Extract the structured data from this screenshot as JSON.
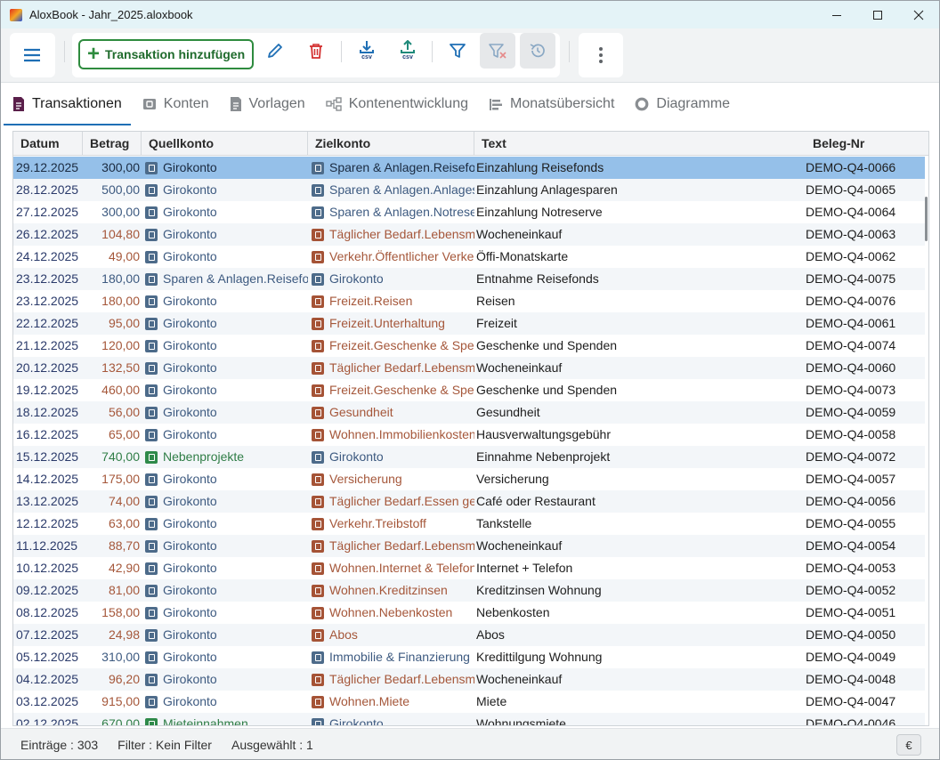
{
  "window": {
    "title": "AloxBook - Jahr_2025.aloxbook"
  },
  "toolbar": {
    "add_label": "Transaktion hinzufügen",
    "csv_label": "csv"
  },
  "tabs": [
    {
      "label": "Transaktionen",
      "icon": "document-icon",
      "active": true
    },
    {
      "label": "Konten",
      "icon": "wallet-icon"
    },
    {
      "label": "Vorlagen",
      "icon": "template-icon"
    },
    {
      "label": "Kontenentwicklung",
      "icon": "hierarchy-icon"
    },
    {
      "label": "Monatsübersicht",
      "icon": "list-icon"
    },
    {
      "label": "Diagramme",
      "icon": "donut-chart-icon"
    }
  ],
  "columns": [
    "Datum",
    "Betrag",
    "Quellkonto",
    "Zielkonto",
    "Text",
    "Beleg-Nr"
  ],
  "colors": {
    "asset": "#3d5a80",
    "expense": "#a5573a",
    "income": "#2f7d46",
    "selected_row": "#95c0e9"
  },
  "rows": [
    {
      "date": "29.12.2025",
      "amount": "300,00",
      "amount_type": "asset",
      "src": "Girokonto",
      "src_type": "asset",
      "dst": "Sparen & Anlagen.Reisefonds",
      "dst_type": "asset",
      "text": "Einzahlung Reisefonds",
      "beleg": "DEMO-Q4-0066",
      "selected": true
    },
    {
      "date": "28.12.2025",
      "amount": "500,00",
      "amount_type": "asset",
      "src": "Girokonto",
      "src_type": "asset",
      "dst": "Sparen & Anlagen.Anlagesparen",
      "dst_type": "asset",
      "text": "Einzahlung Anlagesparen",
      "beleg": "DEMO-Q4-0065"
    },
    {
      "date": "27.12.2025",
      "amount": "300,00",
      "amount_type": "asset",
      "src": "Girokonto",
      "src_type": "asset",
      "dst": "Sparen & Anlagen.Notreserve",
      "dst_type": "asset",
      "text": "Einzahlung Notreserve",
      "beleg": "DEMO-Q4-0064"
    },
    {
      "date": "26.12.2025",
      "amount": "104,80",
      "amount_type": "expense",
      "src": "Girokonto",
      "src_type": "asset",
      "dst": "Täglicher Bedarf.Lebensmittel",
      "dst_type": "expense",
      "text": "Wocheneinkauf",
      "beleg": "DEMO-Q4-0063"
    },
    {
      "date": "24.12.2025",
      "amount": "49,00",
      "amount_type": "expense",
      "src": "Girokonto",
      "src_type": "asset",
      "dst": "Verkehr.Öffentlicher Verkehr",
      "dst_type": "expense",
      "text": "Öffi-Monatskarte",
      "beleg": "DEMO-Q4-0062"
    },
    {
      "date": "23.12.2025",
      "amount": "180,00",
      "amount_type": "asset",
      "src": "Sparen & Anlagen.Reisefonds",
      "src_type": "asset",
      "dst": "Girokonto",
      "dst_type": "asset",
      "text": "Entnahme Reisefonds",
      "beleg": "DEMO-Q4-0075"
    },
    {
      "date": "23.12.2025",
      "amount": "180,00",
      "amount_type": "expense",
      "src": "Girokonto",
      "src_type": "asset",
      "dst": "Freizeit.Reisen",
      "dst_type": "expense",
      "text": "Reisen",
      "beleg": "DEMO-Q4-0076"
    },
    {
      "date": "22.12.2025",
      "amount": "95,00",
      "amount_type": "expense",
      "src": "Girokonto",
      "src_type": "asset",
      "dst": "Freizeit.Unterhaltung",
      "dst_type": "expense",
      "text": "Freizeit",
      "beleg": "DEMO-Q4-0061"
    },
    {
      "date": "21.12.2025",
      "amount": "120,00",
      "amount_type": "expense",
      "src": "Girokonto",
      "src_type": "asset",
      "dst": "Freizeit.Geschenke & Spenden",
      "dst_type": "expense",
      "text": "Geschenke und Spenden",
      "beleg": "DEMO-Q4-0074"
    },
    {
      "date": "20.12.2025",
      "amount": "132,50",
      "amount_type": "expense",
      "src": "Girokonto",
      "src_type": "asset",
      "dst": "Täglicher Bedarf.Lebensmittel",
      "dst_type": "expense",
      "text": "Wocheneinkauf",
      "beleg": "DEMO-Q4-0060"
    },
    {
      "date": "19.12.2025",
      "amount": "460,00",
      "amount_type": "expense",
      "src": "Girokonto",
      "src_type": "asset",
      "dst": "Freizeit.Geschenke & Spenden",
      "dst_type": "expense",
      "text": "Geschenke und Spenden",
      "beleg": "DEMO-Q4-0073"
    },
    {
      "date": "18.12.2025",
      "amount": "56,00",
      "amount_type": "expense",
      "src": "Girokonto",
      "src_type": "asset",
      "dst": "Gesundheit",
      "dst_type": "expense",
      "text": "Gesundheit",
      "beleg": "DEMO-Q4-0059"
    },
    {
      "date": "16.12.2025",
      "amount": "65,00",
      "amount_type": "expense",
      "src": "Girokonto",
      "src_type": "asset",
      "dst": "Wohnen.Immobilienkosten",
      "dst_type": "expense",
      "text": "Hausverwaltungsgebühr",
      "beleg": "DEMO-Q4-0058"
    },
    {
      "date": "15.12.2025",
      "amount": "740,00",
      "amount_type": "income",
      "src": "Nebenprojekte",
      "src_type": "income",
      "dst": "Girokonto",
      "dst_type": "asset",
      "text": "Einnahme Nebenprojekt",
      "beleg": "DEMO-Q4-0072"
    },
    {
      "date": "14.12.2025",
      "amount": "175,00",
      "amount_type": "expense",
      "src": "Girokonto",
      "src_type": "asset",
      "dst": "Versicherung",
      "dst_type": "expense",
      "text": "Versicherung",
      "beleg": "DEMO-Q4-0057"
    },
    {
      "date": "13.12.2025",
      "amount": "74,00",
      "amount_type": "expense",
      "src": "Girokonto",
      "src_type": "asset",
      "dst": "Täglicher Bedarf.Essen gehen",
      "dst_type": "expense",
      "text": "Café oder Restaurant",
      "beleg": "DEMO-Q4-0056"
    },
    {
      "date": "12.12.2025",
      "amount": "63,00",
      "amount_type": "expense",
      "src": "Girokonto",
      "src_type": "asset",
      "dst": "Verkehr.Treibstoff",
      "dst_type": "expense",
      "text": "Tankstelle",
      "beleg": "DEMO-Q4-0055"
    },
    {
      "date": "11.12.2025",
      "amount": "88,70",
      "amount_type": "expense",
      "src": "Girokonto",
      "src_type": "asset",
      "dst": "Täglicher Bedarf.Lebensmittel",
      "dst_type": "expense",
      "text": "Wocheneinkauf",
      "beleg": "DEMO-Q4-0054"
    },
    {
      "date": "10.12.2025",
      "amount": "42,90",
      "amount_type": "expense",
      "src": "Girokonto",
      "src_type": "asset",
      "dst": "Wohnen.Internet & Telefon",
      "dst_type": "expense",
      "text": "Internet + Telefon",
      "beleg": "DEMO-Q4-0053"
    },
    {
      "date": "09.12.2025",
      "amount": "81,00",
      "amount_type": "expense",
      "src": "Girokonto",
      "src_type": "asset",
      "dst": "Wohnen.Kreditzinsen",
      "dst_type": "expense",
      "text": "Kreditzinsen Wohnung",
      "beleg": "DEMO-Q4-0052"
    },
    {
      "date": "08.12.2025",
      "amount": "158,00",
      "amount_type": "expense",
      "src": "Girokonto",
      "src_type": "asset",
      "dst": "Wohnen.Nebenkosten",
      "dst_type": "expense",
      "text": "Nebenkosten",
      "beleg": "DEMO-Q4-0051"
    },
    {
      "date": "07.12.2025",
      "amount": "24,98",
      "amount_type": "expense",
      "src": "Girokonto",
      "src_type": "asset",
      "dst": "Abos",
      "dst_type": "expense",
      "text": "Abos",
      "beleg": "DEMO-Q4-0050"
    },
    {
      "date": "05.12.2025",
      "amount": "310,00",
      "amount_type": "asset",
      "src": "Girokonto",
      "src_type": "asset",
      "dst": "Immobilie & Finanzierung",
      "dst_type": "asset",
      "text": "Kredittilgung Wohnung",
      "beleg": "DEMO-Q4-0049"
    },
    {
      "date": "04.12.2025",
      "amount": "96,20",
      "amount_type": "expense",
      "src": "Girokonto",
      "src_type": "asset",
      "dst": "Täglicher Bedarf.Lebensmittel",
      "dst_type": "expense",
      "text": "Wocheneinkauf",
      "beleg": "DEMO-Q4-0048"
    },
    {
      "date": "03.12.2025",
      "amount": "915,00",
      "amount_type": "expense",
      "src": "Girokonto",
      "src_type": "asset",
      "dst": "Wohnen.Miete",
      "dst_type": "expense",
      "text": "Miete",
      "beleg": "DEMO-Q4-0047"
    },
    {
      "date": "02.12.2025",
      "amount": "670,00",
      "amount_type": "income",
      "src": "Mieteinnahmen",
      "src_type": "income",
      "dst": "Girokonto",
      "dst_type": "asset",
      "text": "Wohnungsmiete",
      "beleg": "DEMO-Q4-0046"
    }
  ],
  "status": {
    "entries": "Einträge : 303",
    "filter": "Filter : Kein Filter",
    "selected": "Ausgewählt : 1",
    "currency": "€"
  }
}
